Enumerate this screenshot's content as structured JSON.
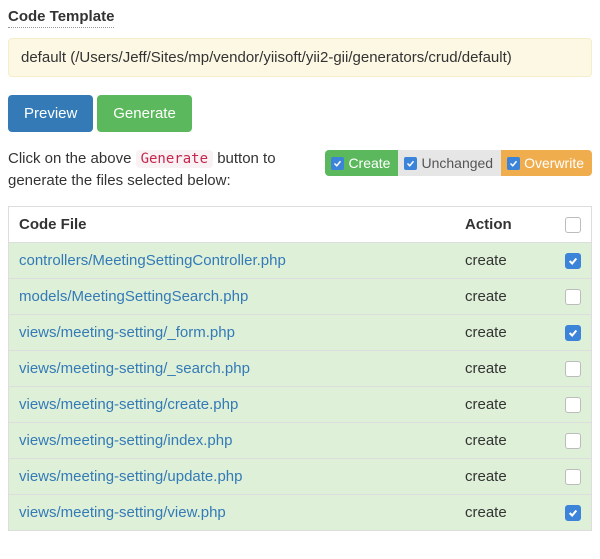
{
  "template": {
    "label": "Code Template",
    "value": "default (/Users/Jeff/Sites/mp/vendor/yiisoft/yii2-gii/generators/crud/default)"
  },
  "buttons": {
    "preview": "Preview",
    "generate": "Generate"
  },
  "help": {
    "prefix": "Click on the above ",
    "code": "Generate",
    "suffix": " button to generate the files selected below:"
  },
  "filters": {
    "create": "Create",
    "unchanged": "Unchanged",
    "overwrite": "Overwrite"
  },
  "table": {
    "headers": {
      "file": "Code File",
      "action": "Action"
    },
    "rows": [
      {
        "file": "controllers/MeetingSettingController.php",
        "action": "create",
        "checked": true
      },
      {
        "file": "models/MeetingSettingSearch.php",
        "action": "create",
        "checked": false
      },
      {
        "file": "views/meeting-setting/_form.php",
        "action": "create",
        "checked": true
      },
      {
        "file": "views/meeting-setting/_search.php",
        "action": "create",
        "checked": false
      },
      {
        "file": "views/meeting-setting/create.php",
        "action": "create",
        "checked": false
      },
      {
        "file": "views/meeting-setting/index.php",
        "action": "create",
        "checked": false
      },
      {
        "file": "views/meeting-setting/update.php",
        "action": "create",
        "checked": false
      },
      {
        "file": "views/meeting-setting/view.php",
        "action": "create",
        "checked": true
      }
    ],
    "select_all_checked": false
  }
}
